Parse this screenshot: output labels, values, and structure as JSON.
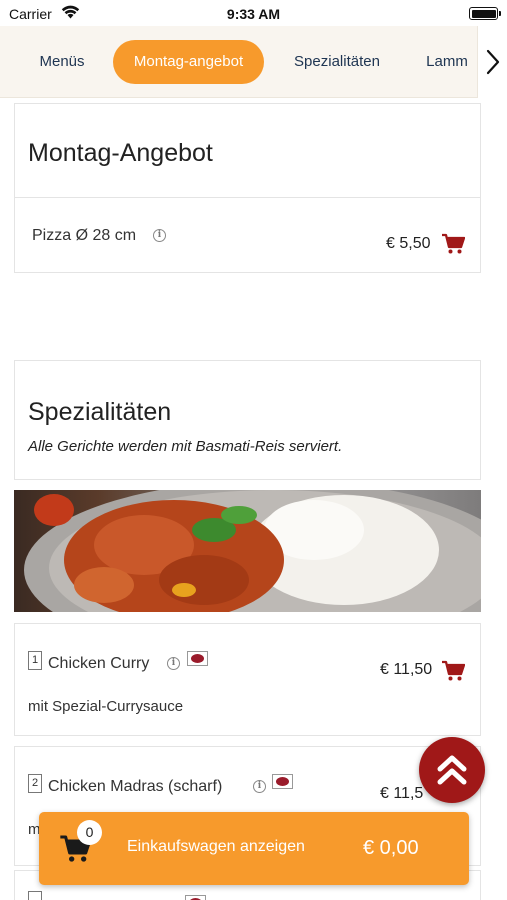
{
  "status_bar": {
    "carrier": "Carrier",
    "time": "9:33 AM"
  },
  "tabs": [
    {
      "label": "Menüs",
      "active": false
    },
    {
      "label": "Montag-angebot",
      "active": true
    },
    {
      "label": "Spezialitäten",
      "active": false
    },
    {
      "label": "Lamm",
      "active": false
    }
  ],
  "colors": {
    "accent": "#f79a2c",
    "cart_icon": "#a01818",
    "tab_text": "#1f3552"
  },
  "sections": [
    {
      "title": "Montag-Angebot",
      "note": "",
      "items": [
        {
          "number": "",
          "name": "Pizza Ø 28 cm",
          "price": "€ 5,50",
          "description": ""
        }
      ]
    },
    {
      "title": "Spezialitäten",
      "note": "Alle Gerichte werden mit Basmati-Reis serviert.",
      "items": [
        {
          "number": "1",
          "name": "Chicken Curry",
          "price": "€ 11,50",
          "description": "mit Spezial-Currysauce"
        },
        {
          "number": "2",
          "name": "Chicken Madras (scharf)",
          "price": "€ 11,5",
          "description": "m"
        }
      ]
    }
  ],
  "cart": {
    "count": "0",
    "label": "Einkaufswagen anzeigen",
    "total": "€ 0,00"
  }
}
